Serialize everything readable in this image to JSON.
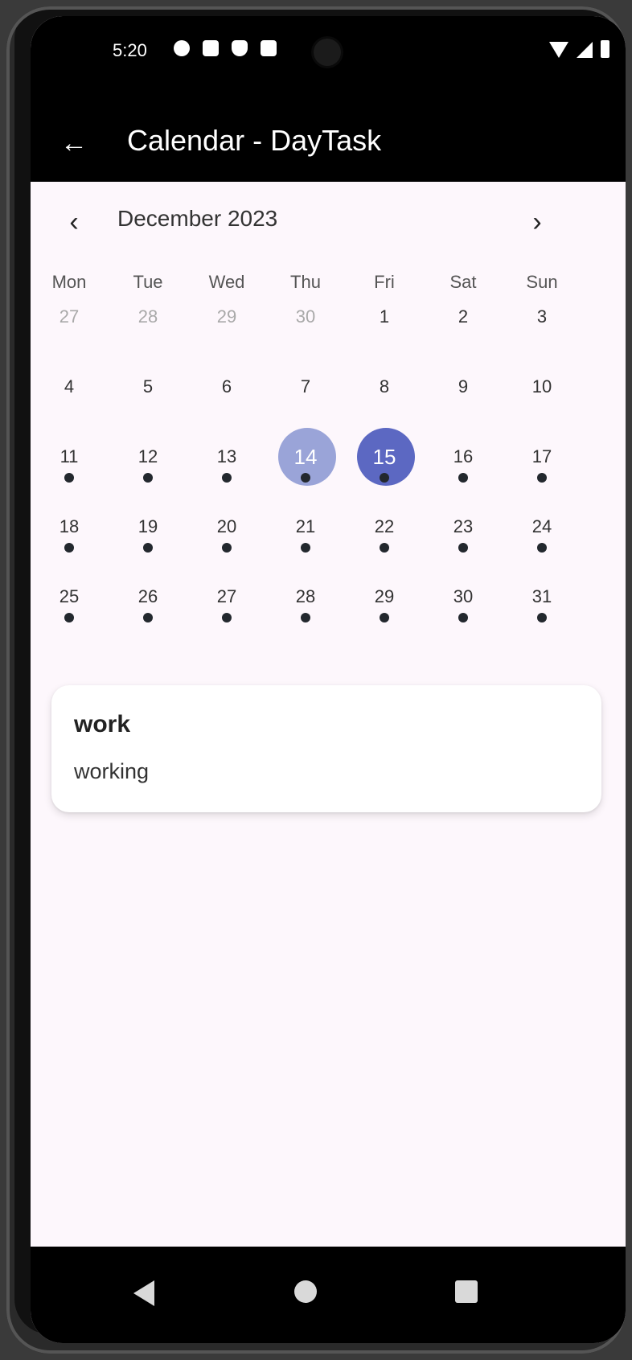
{
  "status_bar": {
    "time": "5:20",
    "icons_left": [
      "gear-icon",
      "a-icon",
      "shield-icon",
      "sd-card-icon"
    ],
    "icons_right": [
      "wifi-icon",
      "signal-icon",
      "battery-icon"
    ]
  },
  "app_bar": {
    "back_icon": "←",
    "title": "Calendar - DayTask"
  },
  "calendar": {
    "month_title": "December 2023",
    "prev_icon": "‹",
    "next_icon": "›",
    "weekdays": [
      "Mon",
      "Tue",
      "Wed",
      "Thu",
      "Fri",
      "Sat",
      "Sun"
    ],
    "weeks": [
      [
        {
          "label": "27",
          "out": true
        },
        {
          "label": "28",
          "out": true
        },
        {
          "label": "29",
          "out": true
        },
        {
          "label": "30",
          "out": true
        },
        {
          "label": "1"
        },
        {
          "label": "2"
        },
        {
          "label": "3"
        }
      ],
      [
        {
          "label": "4"
        },
        {
          "label": "5"
        },
        {
          "label": "6"
        },
        {
          "label": "7"
        },
        {
          "label": "8"
        },
        {
          "label": "9"
        },
        {
          "label": "10"
        }
      ],
      [
        {
          "label": "11",
          "dot": true
        },
        {
          "label": "12",
          "dot": true
        },
        {
          "label": "13",
          "dot": true
        },
        {
          "label": "14",
          "dot": true,
          "today": true
        },
        {
          "label": "15",
          "dot": true,
          "selected": true
        },
        {
          "label": "16",
          "dot": true
        },
        {
          "label": "17",
          "dot": true
        }
      ],
      [
        {
          "label": "18",
          "dot": true
        },
        {
          "label": "19",
          "dot": true
        },
        {
          "label": "20",
          "dot": true
        },
        {
          "label": "21",
          "dot": true
        },
        {
          "label": "22",
          "dot": true
        },
        {
          "label": "23",
          "dot": true
        },
        {
          "label": "24",
          "dot": true
        }
      ],
      [
        {
          "label": "25",
          "dot": true
        },
        {
          "label": "26",
          "dot": true
        },
        {
          "label": "27",
          "dot": true
        },
        {
          "label": "28",
          "dot": true
        },
        {
          "label": "29",
          "dot": true
        },
        {
          "label": "30",
          "dot": true
        },
        {
          "label": "31",
          "dot": true
        }
      ]
    ]
  },
  "event": {
    "title": "work",
    "description": "working"
  },
  "colors": {
    "today_highlight": "#9aa4d8",
    "selected_highlight": "#5c68c2",
    "event_dot": "#23282e",
    "background": "#fdf7fc"
  },
  "nav_bar": {
    "icons": [
      "back-triangle-icon",
      "home-circle-icon",
      "recents-square-icon"
    ]
  }
}
